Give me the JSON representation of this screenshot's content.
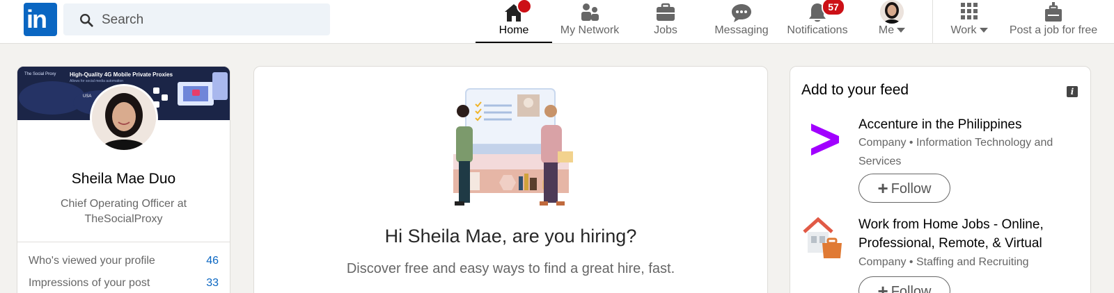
{
  "brand": {
    "logo_text": "in"
  },
  "search": {
    "placeholder": "Search"
  },
  "nav": {
    "home": "Home",
    "network": "My Network",
    "jobs": "Jobs",
    "messaging": "Messaging",
    "notifications": "Notifications",
    "notifications_count": "57",
    "me": "Me",
    "work": "Work",
    "post_job": "Post a job for free"
  },
  "profile": {
    "banner_title": "High-Quality 4G Mobile Private Proxies",
    "banner_subtitle": "Allows for social media automation",
    "banner_brand": "The Social Proxy",
    "banner_country": "USA",
    "name": "Sheila Mae Duo",
    "headline": "Chief Operating Officer at TheSocialProxy",
    "stats": [
      {
        "label": "Who's viewed your profile",
        "value": "46"
      },
      {
        "label": "Impressions of your post",
        "value": "33"
      }
    ]
  },
  "hiring": {
    "title": "Hi Sheila Mae, are you hiring?",
    "subtitle": "Discover free and easy ways to find a great hire, fast."
  },
  "feed": {
    "title": "Add to your feed",
    "items": [
      {
        "name": "Accenture in the Philippines",
        "meta": "Company • Information Technology and Services",
        "follow": "Follow",
        "logo_color": "#a100ff"
      },
      {
        "name": "Work from Home Jobs - Online, Professional, Remote, & Virtual",
        "meta": "Company • Staffing and Recruiting",
        "follow": "Follow",
        "logo_color": "#e06d3a"
      }
    ]
  },
  "colors": {
    "accent": "#0a66c2",
    "badge": "#cc1016",
    "page_bg": "#f3f2ef"
  }
}
